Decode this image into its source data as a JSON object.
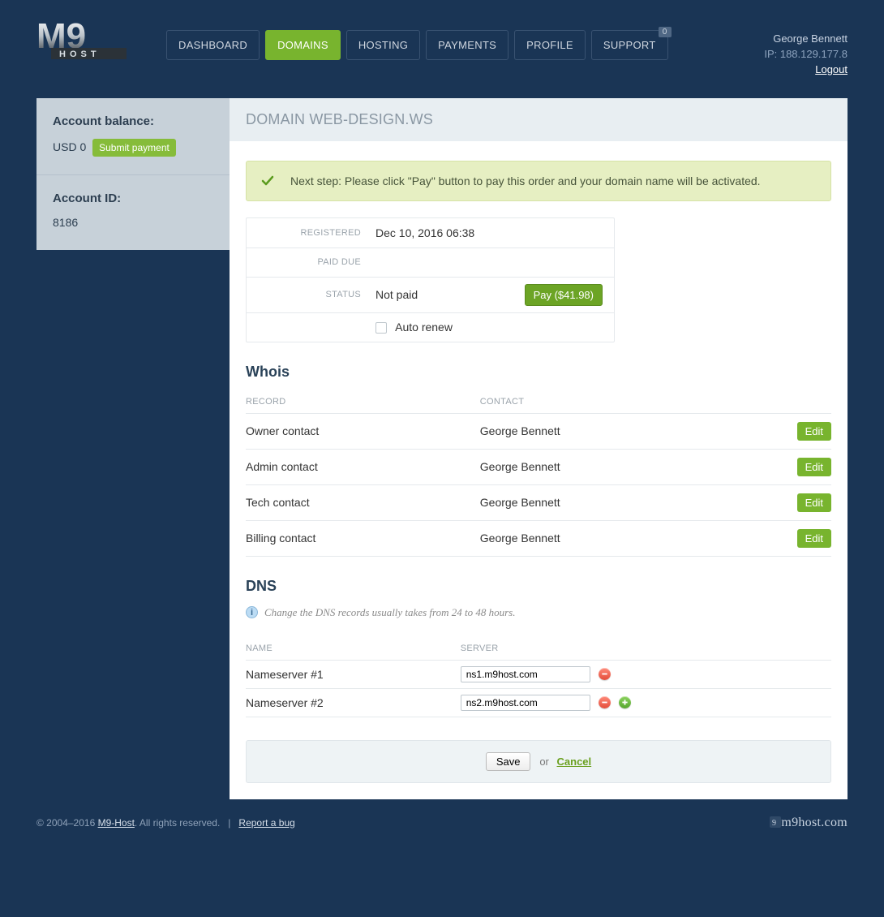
{
  "nav": {
    "items": [
      {
        "label": "DASHBOARD",
        "active": false
      },
      {
        "label": "DOMAINS",
        "active": true
      },
      {
        "label": "HOSTING",
        "active": false
      },
      {
        "label": "PAYMENTS",
        "active": false
      },
      {
        "label": "PROFILE",
        "active": false
      },
      {
        "label": "SUPPORT",
        "active": false,
        "badge": "0"
      }
    ]
  },
  "user": {
    "name": "George Bennett",
    "ip_label": "IP: 188.129.177.8",
    "logout": "Logout"
  },
  "sidebar": {
    "balance_title": "Account balance:",
    "balance_value": "USD 0",
    "submit_payment": "Submit payment",
    "account_id_title": "Account ID:",
    "account_id_value": "8186"
  },
  "content": {
    "title": "DOMAIN WEB-DESIGN.WS",
    "alert": "Next step: Please click \"Pay\" button to pay this order and your domain name will be activated."
  },
  "details": {
    "registered_label": "REGISTERED",
    "registered_value": "Dec 10, 2016 06:38",
    "paid_due_label": "PAID DUE",
    "paid_due_value": "",
    "status_label": "STATUS",
    "status_value": "Not paid",
    "pay_button": "Pay ($41.98)",
    "auto_renew_label": "Auto renew"
  },
  "whois": {
    "heading": "Whois",
    "col_record": "RECORD",
    "col_contact": "CONTACT",
    "edit_label": "Edit",
    "rows": [
      {
        "record": "Owner contact",
        "contact": "George Bennett"
      },
      {
        "record": "Admin contact",
        "contact": "George Bennett"
      },
      {
        "record": "Tech contact",
        "contact": "George Bennett"
      },
      {
        "record": "Billing contact",
        "contact": "George Bennett"
      }
    ]
  },
  "dns": {
    "heading": "DNS",
    "note": "Change the DNS records usually takes from 24 to 48 hours.",
    "col_name": "NAME",
    "col_server": "SERVER",
    "rows": [
      {
        "name": "Nameserver #1",
        "server": "ns1.m9host.com"
      },
      {
        "name": "Nameserver #2",
        "server": "ns2.m9host.com"
      }
    ]
  },
  "form": {
    "save": "Save",
    "or": "or",
    "cancel": "Cancel"
  },
  "footer": {
    "copyright_prefix": "© 2004–2016 ",
    "brand_link": "M9-Host",
    "copyright_suffix": ". All rights reserved.",
    "report_bug": "Report a bug",
    "brand": "m9host.com"
  }
}
